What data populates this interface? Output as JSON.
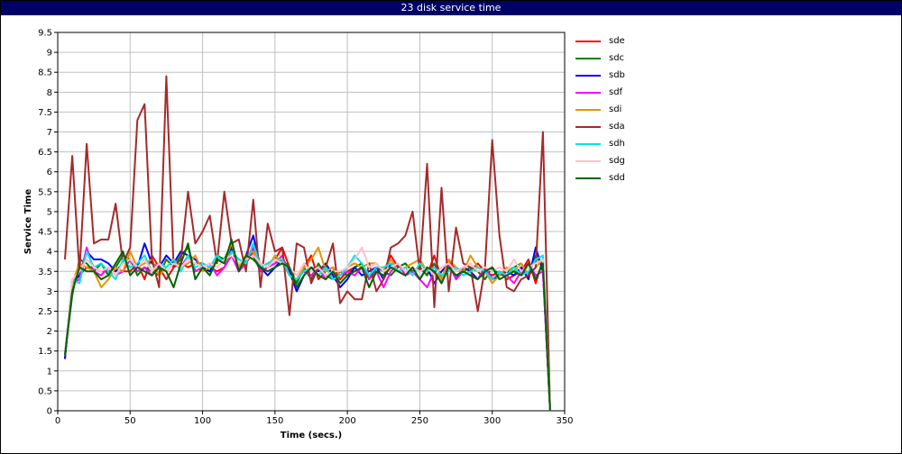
{
  "window": {
    "title": "23 disk service time"
  },
  "chart_data": {
    "type": "line",
    "title": "23 disk service time",
    "xlabel": "Time (secs.)",
    "ylabel": "Service Time",
    "xlim": [
      0,
      350
    ],
    "ylim": [
      0,
      9.5
    ],
    "xticks": [
      "0",
      "50",
      "100",
      "150",
      "200",
      "250",
      "300",
      "350"
    ],
    "yticks": [
      "0",
      "0.5",
      "1",
      "1.5",
      "2",
      "2.5",
      "3",
      "3.5",
      "4",
      "4.5",
      "5",
      "5.5",
      "6",
      "6.5",
      "7",
      "7.5",
      "8",
      "8.5",
      "9",
      "9.5"
    ],
    "grid": true,
    "legend_position": "right",
    "x": [
      5,
      10,
      15,
      20,
      25,
      30,
      35,
      40,
      45,
      50,
      55,
      60,
      65,
      70,
      75,
      80,
      85,
      90,
      95,
      100,
      105,
      110,
      115,
      120,
      125,
      130,
      135,
      140,
      145,
      150,
      155,
      160,
      165,
      170,
      175,
      180,
      185,
      190,
      195,
      200,
      205,
      210,
      215,
      220,
      225,
      230,
      235,
      240,
      245,
      250,
      255,
      260,
      265,
      270,
      275,
      280,
      285,
      290,
      295,
      300,
      305,
      310,
      315,
      320,
      325,
      330,
      335,
      340
    ],
    "series": [
      {
        "name": "sde",
        "color": "#ff0000",
        "values": [
          1.3,
          3.3,
          3.4,
          3.6,
          3.6,
          3.5,
          3.5,
          3.6,
          3.5,
          3.5,
          3.7,
          3.3,
          3.9,
          3.6,
          3.3,
          3.6,
          3.7,
          3.6,
          3.7,
          3.7,
          3.6,
          3.5,
          3.6,
          4.0,
          3.8,
          3.7,
          4.0,
          3.6,
          3.7,
          3.8,
          4.1,
          3.6,
          3.2,
          3.6,
          3.9,
          3.3,
          3.5,
          3.6,
          3.3,
          3.5,
          3.6,
          3.7,
          3.3,
          3.6,
          3.5,
          3.9,
          3.6,
          3.7,
          3.5,
          3.6,
          3.4,
          3.9,
          3.3,
          3.8,
          3.5,
          3.6,
          3.5,
          3.7,
          3.5,
          3.4,
          3.5,
          3.3,
          3.4,
          3.5,
          3.8,
          3.2,
          3.8,
          0.0
        ]
      },
      {
        "name": "sdc",
        "color": "#008000",
        "values": [
          1.4,
          2.9,
          3.8,
          3.7,
          3.5,
          3.7,
          3.4,
          3.6,
          3.9,
          3.8,
          3.4,
          3.6,
          3.5,
          3.4,
          3.8,
          3.6,
          3.9,
          4.1,
          3.5,
          3.6,
          3.5,
          3.9,
          3.8,
          4.2,
          3.5,
          3.8,
          3.9,
          3.5,
          3.6,
          3.7,
          3.8,
          3.6,
          3.2,
          3.6,
          3.3,
          3.7,
          3.4,
          3.3,
          3.5,
          3.4,
          3.6,
          3.7,
          3.3,
          3.6,
          3.5,
          3.4,
          3.6,
          3.7,
          3.5,
          3.6,
          3.4,
          3.7,
          3.3,
          3.6,
          3.4,
          3.5,
          3.6,
          3.5,
          3.3,
          3.6,
          3.4,
          3.5,
          3.6,
          3.7,
          3.4,
          3.9,
          3.6,
          0.0
        ]
      },
      {
        "name": "sdb",
        "color": "#0000ff",
        "values": [
          1.3,
          3.2,
          3.4,
          4.0,
          3.8,
          3.8,
          3.7,
          3.5,
          3.7,
          3.8,
          3.6,
          4.2,
          3.7,
          3.6,
          3.9,
          3.7,
          4.0,
          3.9,
          3.8,
          3.6,
          3.5,
          3.8,
          3.7,
          4.1,
          3.6,
          3.9,
          4.4,
          3.6,
          3.4,
          3.6,
          3.8,
          3.5,
          3.0,
          3.4,
          3.6,
          3.5,
          3.7,
          3.4,
          3.1,
          3.3,
          3.6,
          3.4,
          3.5,
          3.6,
          3.3,
          3.7,
          3.5,
          3.4,
          3.5,
          3.3,
          3.6,
          3.2,
          3.5,
          3.7,
          3.3,
          3.6,
          3.5,
          3.3,
          3.6,
          3.3,
          3.4,
          3.5,
          3.4,
          3.6,
          3.3,
          4.1,
          3.5,
          0.0
        ]
      },
      {
        "name": "sdf",
        "color": "#ff00ff",
        "values": [
          1.4,
          3.2,
          3.3,
          4.1,
          3.5,
          3.4,
          3.6,
          3.4,
          3.5,
          3.8,
          3.5,
          3.6,
          3.4,
          3.6,
          3.5,
          3.7,
          3.6,
          3.9,
          3.5,
          3.6,
          3.7,
          3.4,
          3.6,
          3.9,
          3.5,
          3.7,
          4.1,
          3.5,
          3.6,
          3.7,
          3.9,
          3.4,
          3.3,
          3.5,
          3.4,
          3.6,
          3.3,
          3.5,
          3.4,
          3.5,
          3.4,
          3.6,
          3.3,
          3.5,
          3.1,
          3.5,
          3.7,
          3.4,
          3.5,
          3.3,
          3.1,
          3.5,
          3.2,
          3.7,
          3.3,
          3.5,
          3.4,
          3.3,
          3.6,
          3.3,
          3.5,
          3.4,
          3.2,
          3.5,
          3.7,
          3.4,
          3.5,
          0.0
        ]
      },
      {
        "name": "sdi",
        "color": "#e69500",
        "values": [
          1.4,
          3.2,
          3.7,
          3.6,
          3.5,
          3.1,
          3.3,
          3.6,
          3.5,
          4.0,
          3.6,
          3.7,
          3.8,
          3.4,
          3.6,
          3.8,
          3.6,
          3.7,
          3.9,
          3.5,
          3.6,
          3.8,
          3.7,
          4.2,
          3.6,
          3.9,
          4.0,
          3.7,
          3.6,
          3.9,
          3.7,
          3.4,
          3.3,
          3.6,
          3.8,
          4.1,
          3.5,
          3.6,
          3.4,
          3.6,
          3.7,
          3.6,
          3.7,
          3.7,
          3.5,
          3.8,
          3.5,
          3.6,
          3.7,
          3.8,
          3.5,
          3.6,
          3.3,
          3.8,
          3.6,
          3.5,
          3.9,
          3.6,
          3.5,
          3.2,
          3.4,
          3.6,
          3.5,
          3.7,
          3.4,
          3.6,
          3.8,
          0.0
        ]
      },
      {
        "name": "sda",
        "color": "#a52a2a",
        "values": [
          3.8,
          6.4,
          3.5,
          6.7,
          4.2,
          4.3,
          4.3,
          5.2,
          3.7,
          4.1,
          7.3,
          7.7,
          3.8,
          3.1,
          8.4,
          3.6,
          3.8,
          5.5,
          4.2,
          4.5,
          4.9,
          3.7,
          5.5,
          4.2,
          4.3,
          3.5,
          5.3,
          3.1,
          4.7,
          4.0,
          4.1,
          2.4,
          4.2,
          4.1,
          3.2,
          3.6,
          3.6,
          4.2,
          2.7,
          3.0,
          2.8,
          2.8,
          3.7,
          3.0,
          3.3,
          4.1,
          4.2,
          4.4,
          5.0,
          3.5,
          6.2,
          2.6,
          5.6,
          3.0,
          4.6,
          3.7,
          3.6,
          2.5,
          3.6,
          6.8,
          4.4,
          3.1,
          3.0,
          3.3,
          3.4,
          3.6,
          7.0,
          0.0
        ]
      },
      {
        "name": "sdh",
        "color": "#00e5e5",
        "values": [
          1.4,
          3.3,
          3.2,
          4.0,
          3.6,
          3.7,
          3.5,
          3.3,
          3.8,
          3.6,
          3.7,
          3.9,
          3.5,
          3.7,
          3.6,
          3.8,
          3.5,
          3.9,
          3.6,
          3.7,
          3.6,
          3.9,
          3.7,
          4.0,
          3.8,
          3.7,
          4.2,
          3.6,
          3.7,
          3.8,
          3.8,
          3.4,
          3.3,
          3.5,
          3.6,
          3.4,
          3.6,
          3.3,
          3.4,
          3.6,
          3.9,
          3.7,
          3.4,
          3.6,
          3.6,
          3.7,
          3.5,
          3.6,
          3.4,
          3.7,
          3.5,
          3.6,
          3.4,
          3.5,
          3.6,
          3.4,
          3.5,
          3.6,
          3.5,
          3.3,
          3.5,
          3.4,
          3.6,
          3.4,
          3.5,
          3.8,
          3.9,
          0.0
        ]
      },
      {
        "name": "sdg",
        "color": "#ffc0cb",
        "values": [
          1.4,
          3.3,
          3.5,
          3.8,
          3.6,
          3.5,
          3.6,
          3.4,
          3.7,
          3.8,
          3.6,
          3.8,
          3.5,
          3.7,
          3.5,
          3.7,
          3.6,
          3.8,
          3.7,
          3.6,
          3.7,
          3.6,
          3.8,
          3.9,
          3.7,
          3.8,
          3.9,
          3.7,
          3.6,
          3.8,
          3.7,
          3.6,
          3.4,
          3.7,
          3.5,
          3.6,
          3.4,
          3.5,
          3.5,
          3.6,
          3.8,
          4.1,
          3.6,
          3.7,
          3.5,
          3.6,
          3.7,
          3.5,
          3.6,
          3.5,
          3.6,
          3.4,
          3.6,
          3.7,
          3.5,
          3.6,
          3.7,
          3.5,
          3.6,
          3.5,
          3.6,
          3.5,
          3.8,
          3.5,
          3.6,
          3.7,
          3.8,
          0.0
        ]
      },
      {
        "name": "sdd",
        "color": "#006400",
        "values": [
          1.4,
          3.0,
          3.6,
          3.5,
          3.5,
          3.3,
          3.4,
          3.7,
          4.0,
          3.4,
          3.6,
          3.5,
          3.4,
          3.6,
          3.5,
          3.1,
          3.7,
          4.2,
          3.3,
          3.6,
          3.4,
          3.8,
          3.7,
          4.3,
          3.5,
          3.9,
          3.8,
          3.6,
          3.5,
          3.6,
          3.7,
          3.6,
          3.1,
          3.4,
          3.6,
          3.4,
          3.3,
          3.5,
          3.2,
          3.4,
          3.5,
          3.6,
          3.1,
          3.5,
          3.4,
          3.6,
          3.5,
          3.4,
          3.6,
          3.3,
          3.6,
          3.5,
          3.2,
          3.6,
          3.4,
          3.5,
          3.4,
          3.3,
          3.5,
          3.6,
          3.3,
          3.4,
          3.5,
          3.4,
          3.7,
          3.3,
          3.7,
          0.0
        ]
      }
    ]
  }
}
